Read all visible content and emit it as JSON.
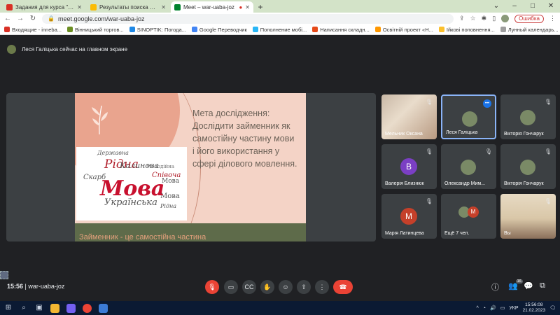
{
  "browser": {
    "tabs": [
      {
        "label": "Задания для курса \"ФБС-13 УКР\"",
        "favicon_color": "#d93025",
        "active": false
      },
      {
        "label": "Результаты поиска – Google Д...",
        "favicon_color": "#fbbc04",
        "active": false
      },
      {
        "label": "Meet – war-uaba-joz",
        "favicon_color": "#00832d",
        "active": true
      }
    ],
    "new_tab": "+",
    "url": "meet.google.com/war-uaba-joz",
    "error_button": "Ошибка",
    "bookmarks": [
      {
        "label": "Входящие - inneba...",
        "color": "#d93025"
      },
      {
        "label": "Вінницький торгов...",
        "color": "#6b8e23"
      },
      {
        "label": "SINOPTIK: Погода...",
        "color": "#1e88e5"
      },
      {
        "label": "Google Переводчик",
        "color": "#4285f4"
      },
      {
        "label": "Пополнение мобі...",
        "color": "#29b6f6"
      },
      {
        "label": "Написання складн...",
        "color": "#e64a19"
      },
      {
        "label": "Освітній проект «Н...",
        "color": "#ff9800"
      },
      {
        "label": "Ійкові поповнення...",
        "color": "#fbc02d"
      },
      {
        "label": "Лунный календарь...",
        "color": "#9e9e9e"
      }
    ],
    "bookmarks_other": "Другие закладки"
  },
  "meet": {
    "presenting_text": "Леся Галіцька сейчас на главном экране",
    "slide": {
      "lines": [
        "Мета дослідження:",
        "Дослідити займенник як",
        "самостійну частину мови",
        "і його використання у",
        "сфері ділового мовлення."
      ],
      "bottom_text": "Займенник - це самостійна частина",
      "wordcloud_main": "Мова",
      "wordcloud_sub": "Українська",
      "wordcloud_words": [
        "Рідна",
        "Калинова",
        "Співоча",
        "Скарб",
        "Мелодійна",
        "Державна",
        "Рідна",
        "Мова",
        "Мова"
      ]
    },
    "participants": [
      {
        "name": "Мельник Оксана",
        "type": "video",
        "mic": "muted"
      },
      {
        "name": "Леся Галіцька",
        "type": "photo",
        "mic": "speaking"
      },
      {
        "name": "Вікторія Гончарук",
        "type": "photo",
        "mic": "muted"
      },
      {
        "name": "Валерія Близнюк",
        "type": "letter",
        "letter": "В",
        "color": "#7b3fc4",
        "mic": "muted"
      },
      {
        "name": "Олександр Мим...",
        "type": "photo",
        "mic": "muted"
      },
      {
        "name": "Вікторія Гончарук",
        "type": "photo",
        "mic": "muted"
      },
      {
        "name": "Марія Латинцева",
        "type": "letter",
        "letter": "М",
        "color": "#c5402a",
        "mic": "muted"
      },
      {
        "name": "Ещё 7 чел.",
        "type": "more",
        "letter": "М",
        "mic": "none"
      },
      {
        "name": "Вы",
        "type": "video",
        "mic": "muted"
      }
    ],
    "time": "15:56",
    "meeting_code": "war-uaba-joz",
    "people_count": "16"
  },
  "taskbar": {
    "lang": "УКР",
    "time": "15:56:08",
    "date": "21.02.2023"
  },
  "icons": {
    "mic_off": "mic-off-icon",
    "camera": "camera-icon",
    "captions": "captions-icon",
    "hand": "raise-hand-icon",
    "emoji": "emoji-icon",
    "present": "present-icon",
    "more": "more-icon",
    "end": "end-call-icon"
  }
}
